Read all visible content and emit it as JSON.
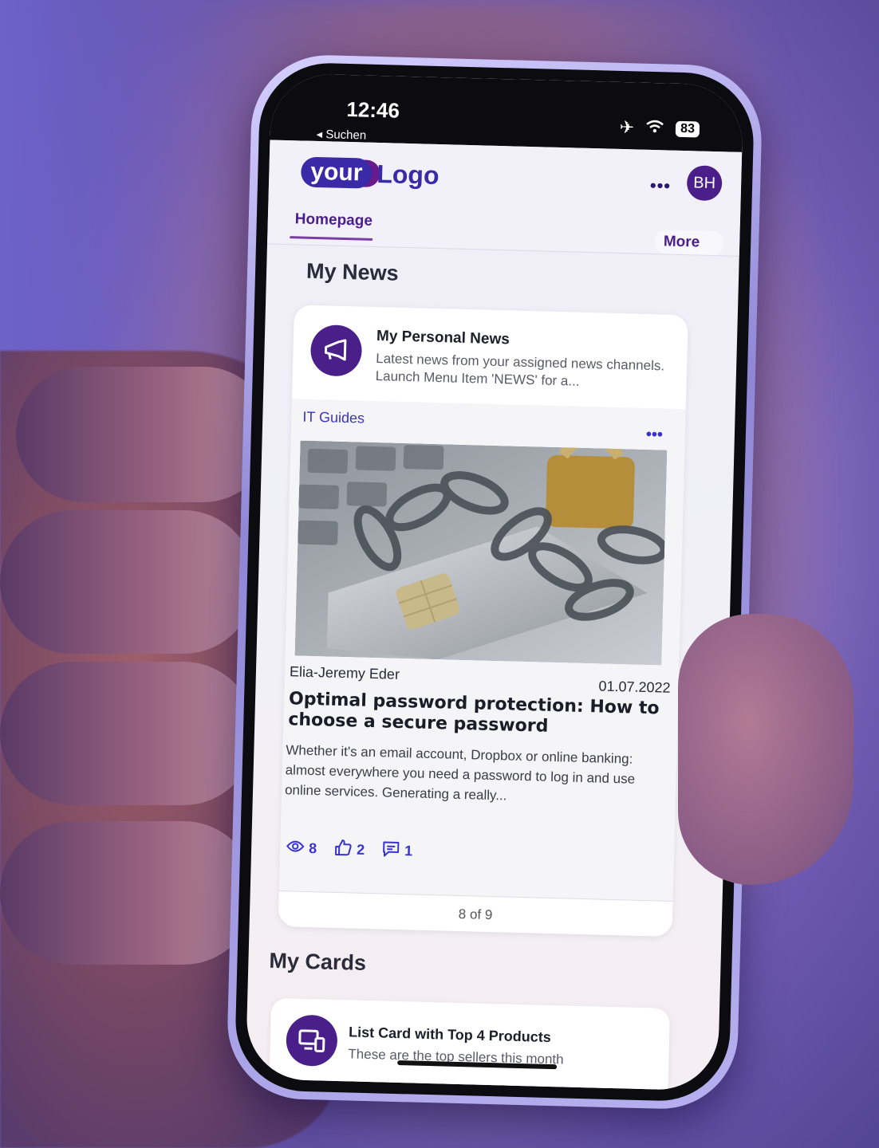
{
  "status_bar": {
    "time": "12:46",
    "back_label": "◂ Suchen",
    "battery": "83"
  },
  "header": {
    "logo_your": "your",
    "logo_text": "Logo",
    "menu_dots": "•••",
    "avatar_initials": "BH"
  },
  "tabs": {
    "active": "Homepage",
    "more": "More"
  },
  "my_news": {
    "section_title": "My News",
    "card_title": "My Personal News",
    "card_description": "Latest news from your assigned news channels. Launch Menu Item 'NEWS' for a...",
    "channel": "IT Guides",
    "channel_menu": "•••",
    "author": "Elia-Jeremy Eder",
    "date": "01.07.2022",
    "headline": "Optimal password protection: How to choose a secure password",
    "excerpt": "Whether it's an email account, Dropbox or online banking: almost everywhere you need a password to log in and use online services. Generating a really...",
    "views": "8",
    "likes": "2",
    "comments": "1",
    "pager": "8 of 9"
  },
  "my_cards": {
    "section_title": "My Cards",
    "card_title": "List Card with Top 4 Products",
    "card_description": "These are the top sellers this month"
  },
  "colors": {
    "brand_purple": "#4b1f8a",
    "link_blue": "#3a33c9"
  }
}
